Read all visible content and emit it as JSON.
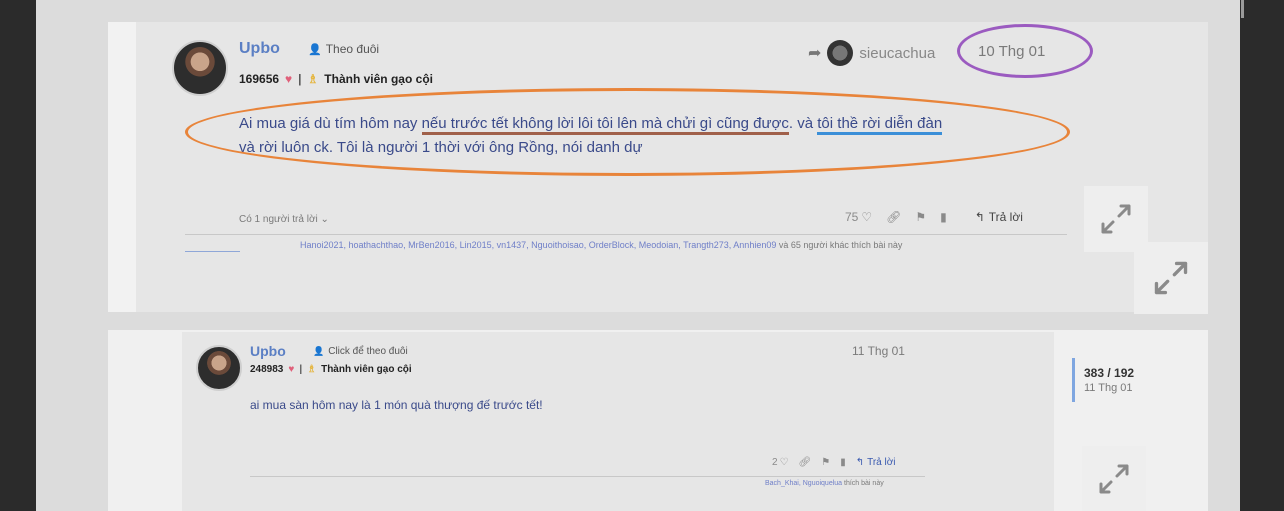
{
  "post1": {
    "username": "Upbo",
    "follow_label": "Theo đuôi",
    "points": "169656",
    "rank": "Thành viên gạo cội",
    "shared_from": "sieucachua",
    "date": "10 Thg 01",
    "content_part1": "Ai mua giá dù tím hôm nay ",
    "content_underlined_red": "nếu trước tết không lời lôi tôi lên mà chửi gì cũng được",
    "content_part2": ". và ",
    "content_underlined_blue": "tôi thề rời diễn đàn",
    "content_line2": "và rời luôn ck. Tôi là người 1 thời với ông Rồng, nói danh dự",
    "replies_label": "Có 1 người trả lời",
    "like_count": "75",
    "reply_label": "Trả lời",
    "likers": "Hanoi2021, hoathachthao, MrBen2016, Lin2015, vn1437, Nguoithoisao, OrderBlock, Meodoian, Trangth273, Annhien09",
    "likers_suffix": "và 65 người khác thích bài này"
  },
  "post2": {
    "username": "Upbo",
    "follow_label": "Click để theo đuôi",
    "points": "248983",
    "rank": "Thành viên gạo cội",
    "date": "11 Thg 01",
    "content": "ai mua sàn hôm nay là 1 món quà thượng đế trước tết!",
    "like_count": "2",
    "reply_label": "Trả lời",
    "likers": "Bach_Khai, Nguoiquelua",
    "likers_suffix": "thích bài này"
  },
  "sidebar": {
    "progress": "383 / 192",
    "date": "11 Thg 01"
  },
  "icons": {
    "follow": "person-plus-icon",
    "heart": "heart-icon",
    "rank": "rank-badge-icon",
    "share": "share-arrow-icon",
    "link": "link-icon",
    "flag": "flag-icon",
    "bookmark": "bookmark-icon",
    "reply": "reply-arrow-icon",
    "expand": "expand-icon"
  },
  "colors": {
    "username": "#5b7fc4",
    "heart": "#e0607a",
    "rank": "#e5b43a",
    "highlight_orange": "#e8843a",
    "highlight_purple": "#9b5bc0",
    "underline_red": "#a0604a",
    "underline_blue": "#3b8fd8"
  }
}
